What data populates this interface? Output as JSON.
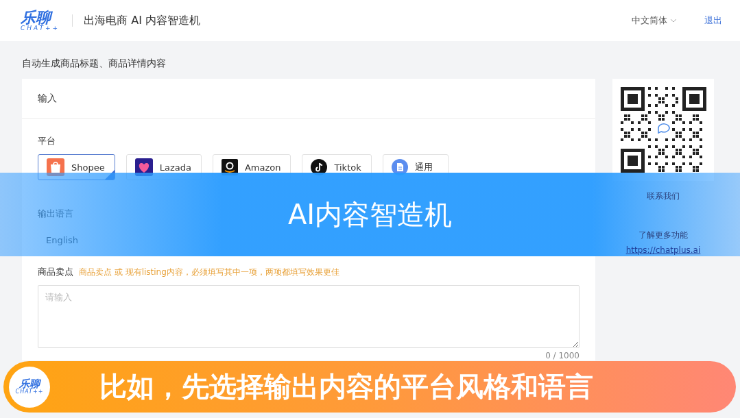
{
  "header": {
    "logo": {
      "title": "乐聊",
      "subtitle": "CHAT++"
    },
    "app_title": "出海电商 AI 内容智造机",
    "language": "中文简体",
    "logout": "退出"
  },
  "page_subtitle": "自动生成商品标题、商品详情内容",
  "input_card": {
    "title": "输入",
    "platform": {
      "label": "平台",
      "options": [
        {
          "kind": "shopee",
          "label": "Shopee",
          "selected": true
        },
        {
          "kind": "lazada",
          "label": "Lazada",
          "selected": false
        },
        {
          "kind": "amazon",
          "label": "Amazon",
          "selected": false
        },
        {
          "kind": "tiktok",
          "label": "Tiktok",
          "selected": false
        },
        {
          "kind": "generic",
          "label": "通用",
          "selected": false
        }
      ]
    },
    "output_language": {
      "label": "输出语言",
      "value": "English"
    },
    "selling_points": {
      "label": "商品卖点",
      "hint": "商品卖点 或 现有listing内容，必须填写其中一项，两项都填写效果更佳",
      "placeholder": "请输入",
      "counter": "0 / 1000"
    }
  },
  "side_panel": {
    "contact": "联系我们",
    "more": "了解更多功能",
    "link": "https://chatplus.ai"
  },
  "title_banner": "AI内容智造机",
  "caption": {
    "logo": {
      "title": "乐聊",
      "subtitle": "CHAT++"
    },
    "text": "比如，先选择输出内容的平台风格和语言"
  }
}
